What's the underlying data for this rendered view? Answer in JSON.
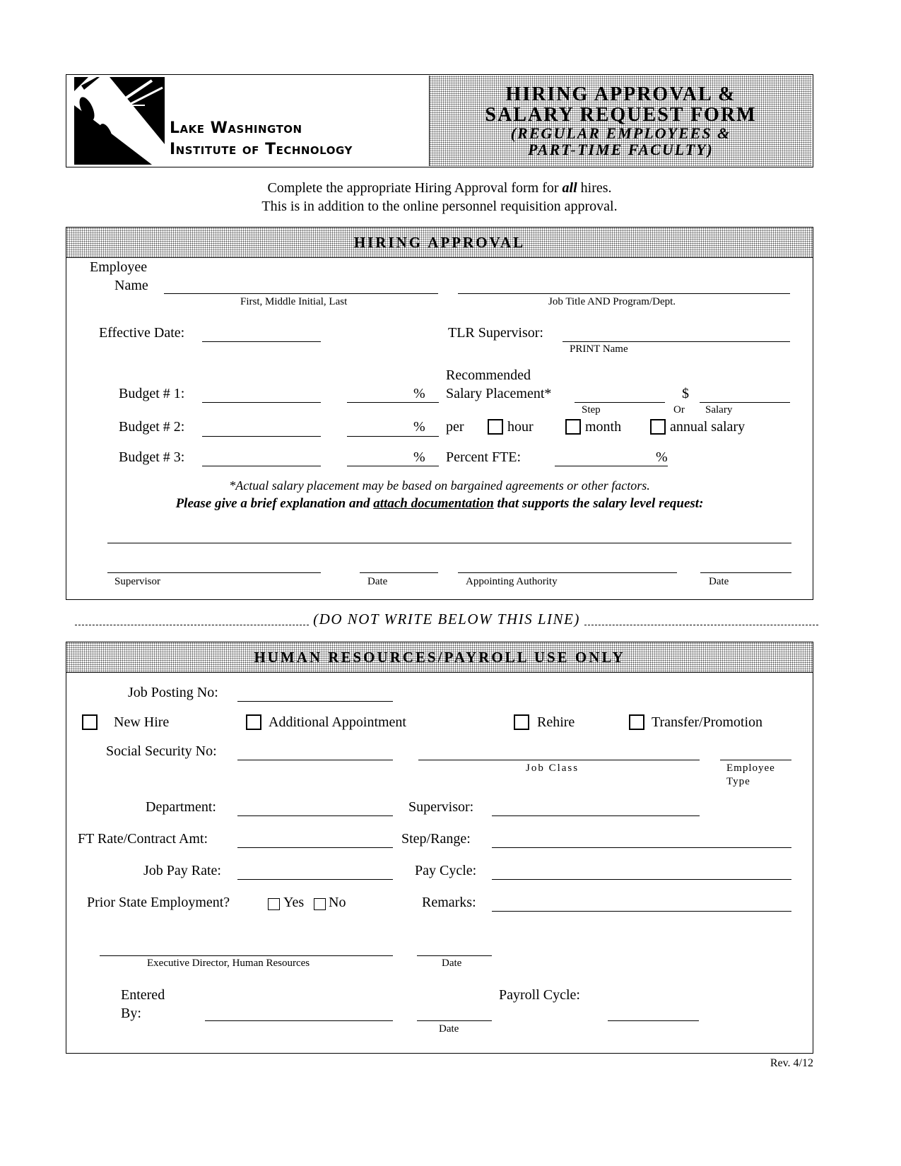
{
  "header": {
    "logo": {
      "line1": "Lake Washington",
      "line2": "Institute of Technology"
    },
    "title_line1": "HIRING APPROVAL &",
    "title_line2": "SALARY REQUEST FORM",
    "subtitle_line1": "(REGULAR EMPLOYEES &",
    "subtitle_line2": "PART-TIME FACULTY)"
  },
  "intro": {
    "line1_pre": "Complete the appropriate Hiring Approval form for ",
    "line1_em": "all",
    "line1_post": " hires.",
    "line2": "This is in addition to the online personnel requisition approval."
  },
  "hiring": {
    "title": "HIRING APPROVAL",
    "employee_label_1": "Employee",
    "employee_label_2": "Name",
    "name_caption": "First, Middle Initial, Last",
    "job_caption": "Job Title AND Program/Dept.",
    "effective_date": "Effective Date:",
    "tlr_supervisor": "TLR Supervisor:",
    "print_name": "PRINT Name",
    "budget1": "Budget # 1:",
    "budget2": "Budget # 2:",
    "budget3": "Budget # 3:",
    "pct": "%",
    "recommended_1": "Recommended",
    "recommended_2": "Salary Placement*",
    "dollar": "$",
    "step": "Step",
    "or": "Or",
    "salary": "Salary",
    "per": "per",
    "hour": "hour",
    "month": "month",
    "annual": "annual salary",
    "percent_fte": "Percent FTE:",
    "note": "*Actual salary placement may be based on bargained agreements or other factors.",
    "explain_pre": "Please give a brief explanation and ",
    "explain_link": "attach documentation",
    "explain_post": " that supports the salary level request:",
    "sig_supervisor": "Supervisor",
    "sig_date1": "Date",
    "sig_authority": "Appointing Authority",
    "sig_date2": "Date"
  },
  "divider": "(DO NOT WRITE BELOW THIS LINE)",
  "hr": {
    "title": "HUMAN RESOURCES/PAYROLL USE ONLY",
    "job_posting": "Job Posting No:",
    "new_hire": "New Hire",
    "additional": "Additional Appointment",
    "rehire": "Rehire",
    "transfer": "Transfer/Promotion",
    "ssn": "Social Security No:",
    "job_class": "Job Class",
    "employee_type_1": "Employee",
    "employee_type_2": "Type",
    "department": "Department:",
    "supervisor": "Supervisor:",
    "ft_rate": "FT Rate/Contract Amt:",
    "step_range": "Step/Range:",
    "job_pay_rate": "Job Pay Rate:",
    "pay_cycle": "Pay Cycle:",
    "prior_state": "Prior State Employment?",
    "yes": "Yes",
    "no": "No",
    "remarks": "Remarks:",
    "exec_director": "Executive Director, Human Resources",
    "date": "Date",
    "entered_1": "Entered",
    "entered_2": "By:",
    "payroll_cycle": "Payroll Cycle:",
    "date2": "Date"
  },
  "footer": {
    "revision": "Rev. 4/12"
  }
}
